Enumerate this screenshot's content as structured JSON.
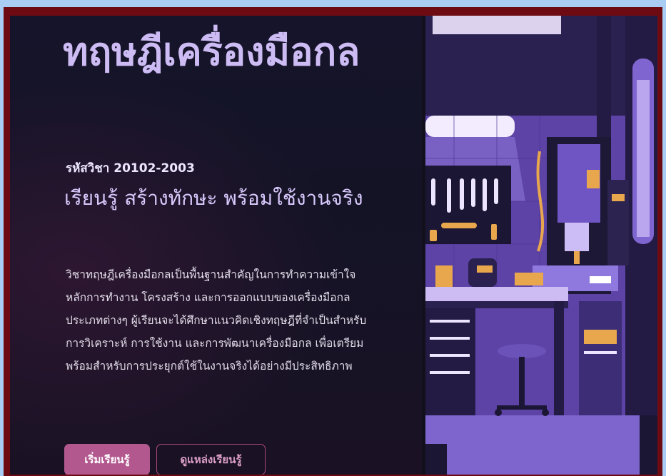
{
  "hero": {
    "title": "ทฤษฎีเครื่องมือกล",
    "course_code": "รหัสวิชา 20102-2003",
    "tagline": "เรียนรู้ สร้างทักษะ พร้อมใช้งานจริง",
    "description": "วิชาทฤษฎีเครื่องมือกลเป็นพื้นฐานสำคัญในการทำความเข้าใจหลักการทำงาน โครงสร้าง และการออกแบบของเครื่องมือกลประเภทต่างๆ ผู้เรียนจะได้ศึกษาแนวคิดเชิงทฤษฎีที่จำเป็นสำหรับการวิเคราะห์ การใช้งาน และการพัฒนาเครื่องมือกล เพื่อเตรียมพร้อมสำหรับการประยุกต์ใช้ในงานจริงได้อย่างมีประสิทธิภาพ"
  },
  "buttons": {
    "start_label": "เริ่มเรียนรู้",
    "resources_label": "ดูแหล่งเรียนรู้"
  },
  "illustration": {
    "subject": "machine-workshop",
    "palette": {
      "wall": "#6c4fb8",
      "dark": "#17132a",
      "accent": "#e8a64d",
      "light": "#b9a6ef"
    }
  }
}
